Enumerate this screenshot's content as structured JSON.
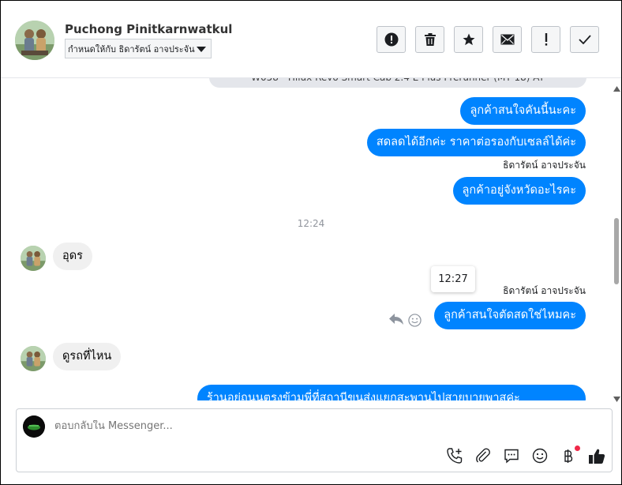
{
  "header": {
    "customer_name": "Puchong Pinitkarnwatkul",
    "assign_label": "กำหนดให้กับ ธิดารัตน์ อาจประจัน",
    "actions": [
      {
        "name": "spam-button",
        "icon": "alert-circle-icon"
      },
      {
        "name": "delete-button",
        "icon": "trash-icon"
      },
      {
        "name": "star-button",
        "icon": "star-icon"
      },
      {
        "name": "mark-unread-button",
        "icon": "envelope-icon"
      },
      {
        "name": "follow-up-button",
        "icon": "exclamation-icon"
      },
      {
        "name": "mark-done-button",
        "icon": "checkmark-icon"
      }
    ]
  },
  "chat": {
    "top_bubble_partial": "W058 - Hilux Revo Smart Cab 2.4 E Plus Prerunner (MY 18) AT",
    "messages": [
      {
        "dir": "out",
        "text": "ลูกค้าสนใจคันนี้นะคะ"
      },
      {
        "dir": "out",
        "text": "สดลดได้อีกค่ะ ราคาต่อรองกับเซลล์ได้ค่ะ"
      },
      {
        "sender": "ธิดารัตน์ อาจประจัน"
      },
      {
        "dir": "out",
        "text": "ลูกค้าอยู่จังหวัดอะไรคะ"
      },
      {
        "timestamp": "12:24"
      },
      {
        "dir": "in",
        "text": "อุดร"
      },
      {
        "tooltip": "12:27"
      },
      {
        "sender": "ธิดารัตน์ อาจประจัน"
      },
      {
        "dir": "out",
        "text": "ลูกค้าสนใจตัดสดใช่ไหมคะ"
      },
      {
        "dir": "in",
        "text": "ดูรถที่ไหน"
      },
      {
        "dir": "out",
        "text": "ร้านอยู่ถนนตรงข้ามพี่ที่สถานีขนส่งแยกสะพานไปสายบายพาสค่ะ",
        "partial": true
      }
    ]
  },
  "composer": {
    "placeholder": "ตอบกลับใน Messenger...",
    "tools": [
      "phone-plus-icon",
      "paperclip-icon",
      "saved-reply-icon",
      "emoji-icon",
      "baht-payment-icon",
      "like-icon"
    ],
    "payment_dot_color": "#f02849"
  },
  "colors": {
    "accent": "#0084ff",
    "incoming_bubble": "#f0f0f0",
    "timestamp": "#90949c"
  }
}
